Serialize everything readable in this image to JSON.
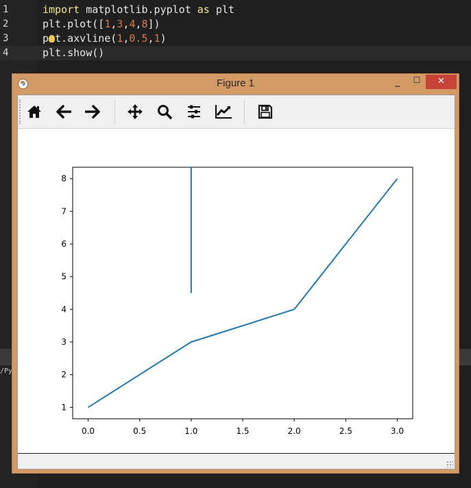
{
  "editor": {
    "lines": [
      {
        "number": "1",
        "tokens": [
          {
            "t": "import",
            "c": "kw"
          },
          {
            "t": " matplotlib.pyplot ",
            "c": ""
          },
          {
            "t": "as",
            "c": "kw"
          },
          {
            "t": " plt",
            "c": ""
          }
        ]
      },
      {
        "number": "2",
        "tokens": [
          {
            "t": "plt.plot([",
            "c": ""
          },
          {
            "t": "1",
            "c": "num"
          },
          {
            "t": ",",
            "c": ""
          },
          {
            "t": "3",
            "c": "num"
          },
          {
            "t": ",",
            "c": ""
          },
          {
            "t": "4",
            "c": "num"
          },
          {
            "t": ",",
            "c": ""
          },
          {
            "t": "8",
            "c": "num"
          },
          {
            "t": "])",
            "c": ""
          }
        ]
      },
      {
        "number": "3",
        "tokens": [
          {
            "t": "p",
            "c": ""
          },
          {
            "t": "HINT",
            "c": "hint"
          },
          {
            "t": "t.axvline(",
            "c": ""
          },
          {
            "t": "1",
            "c": "num"
          },
          {
            "t": ",",
            "c": ""
          },
          {
            "t": "0.5",
            "c": "num"
          },
          {
            "t": ",",
            "c": ""
          },
          {
            "t": "1",
            "c": "num"
          },
          {
            "t": ")",
            "c": ""
          }
        ]
      },
      {
        "number": "4",
        "tokens": [
          {
            "t": "plt.show()",
            "c": ""
          }
        ]
      }
    ],
    "console_fragment": "/Py"
  },
  "window": {
    "title": "Figure 1",
    "minimize_glyph": "_",
    "maximize_glyph": "☐",
    "close_glyph": "✕"
  },
  "toolbar": {
    "items": [
      {
        "name": "home-icon"
      },
      {
        "name": "back-arrow-icon"
      },
      {
        "name": "forward-arrow-icon"
      },
      {
        "name": "pan-icon"
      },
      {
        "name": "zoom-icon"
      },
      {
        "name": "subplots-icon"
      },
      {
        "name": "edit-axis-icon"
      },
      {
        "name": "save-icon"
      }
    ]
  },
  "chart_data": {
    "type": "line",
    "title": "",
    "xlabel": "",
    "ylabel": "",
    "xlim": [
      -0.15,
      3.15
    ],
    "ylim": [
      0.65,
      8.35
    ],
    "xticks": [
      0.0,
      0.5,
      1.0,
      1.5,
      2.0,
      2.5,
      3.0
    ],
    "xtick_labels": [
      "0.0",
      "0.5",
      "1.0",
      "1.5",
      "2.0",
      "2.5",
      "3.0"
    ],
    "yticks": [
      1,
      2,
      3,
      4,
      5,
      6,
      7,
      8
    ],
    "ytick_labels": [
      "1",
      "2",
      "3",
      "4",
      "5",
      "6",
      "7",
      "8"
    ],
    "series": [
      {
        "x": [
          0,
          1,
          2,
          3
        ],
        "y": [
          1,
          3,
          4,
          8
        ],
        "color": "#1f77b4"
      }
    ],
    "vlines": [
      {
        "x": 1,
        "ymin_frac": 0.5,
        "ymax_frac": 1,
        "color": "#1f77b4"
      }
    ],
    "grid": false
  }
}
